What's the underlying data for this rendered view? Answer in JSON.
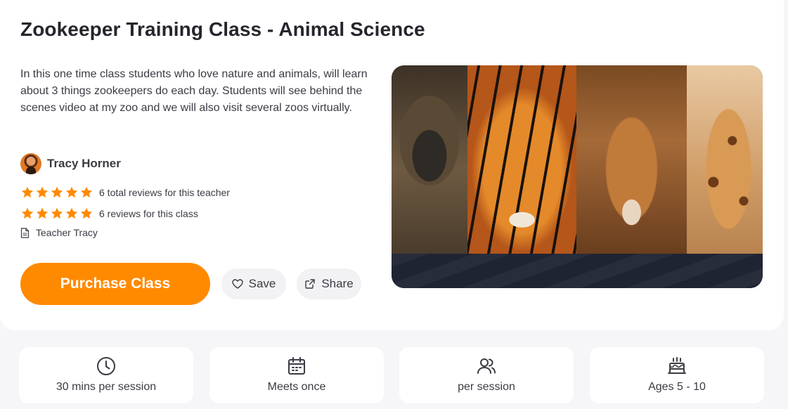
{
  "class": {
    "title": "Zookeeper Training Class - Animal Science",
    "description": "In this one time class students who love nature and animals, will learn about 3 things zookeepers do each day. Students will see behind the scenes video at my zoo and we will also visit several zoos virtually."
  },
  "teacher": {
    "name": "Tracy Horner",
    "byline": "Teacher Tracy"
  },
  "reviews": {
    "teacher_rating": 5,
    "teacher_text": "6 total reviews for this teacher",
    "class_rating": 5,
    "class_text": "6 reviews for this class"
  },
  "actions": {
    "purchase_label": "Purchase Class",
    "save_label": "Save",
    "share_label": "Share"
  },
  "info_cards": [
    {
      "icon": "clock-icon",
      "label": "30 mins per session"
    },
    {
      "icon": "calendar-icon",
      "label": "Meets once"
    },
    {
      "icon": "users-icon",
      "label": "per session"
    },
    {
      "icon": "cake-icon",
      "label": "Ages 5 - 10"
    }
  ],
  "colors": {
    "accent": "#ff8a00",
    "text": "#2b2b33",
    "hero_bottom": "#1f2433"
  }
}
